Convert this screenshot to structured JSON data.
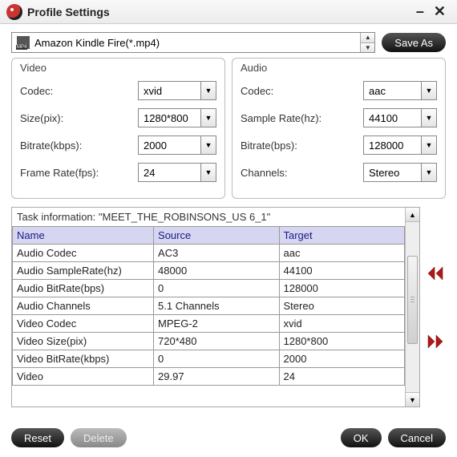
{
  "window": {
    "title": "Profile Settings"
  },
  "profile": {
    "selected": "Amazon Kindle Fire(*.mp4)",
    "save_as": "Save As"
  },
  "video": {
    "legend": "Video",
    "codec_label": "Codec:",
    "codec": "xvid",
    "size_label": "Size(pix):",
    "size": "1280*800",
    "bitrate_label": "Bitrate(kbps):",
    "bitrate": "2000",
    "fps_label": "Frame Rate(fps):",
    "fps": "24"
  },
  "audio": {
    "legend": "Audio",
    "codec_label": "Codec:",
    "codec": "aac",
    "rate_label": "Sample Rate(hz):",
    "rate": "44100",
    "bitrate_label": "Bitrate(bps):",
    "bitrate": "128000",
    "channels_label": "Channels:",
    "channels": "Stereo"
  },
  "task": {
    "title": "Task information: \"MEET_THE_ROBINSONS_US 6_1\"",
    "headers": {
      "name": "Name",
      "source": "Source",
      "target": "Target"
    },
    "rows": [
      {
        "n": "Audio Codec",
        "s": "AC3",
        "t": "aac"
      },
      {
        "n": "Audio SampleRate(hz)",
        "s": "48000",
        "t": "44100"
      },
      {
        "n": "Audio BitRate(bps)",
        "s": "0",
        "t": "128000"
      },
      {
        "n": "Audio Channels",
        "s": "5.1 Channels",
        "t": "Stereo"
      },
      {
        "n": "Video Codec",
        "s": "MPEG-2",
        "t": "xvid"
      },
      {
        "n": "Video Size(pix)",
        "s": "720*480",
        "t": "1280*800"
      },
      {
        "n": "Video BitRate(kbps)",
        "s": "0",
        "t": "2000"
      },
      {
        "n": "Video",
        "s": "29.97",
        "t": "24"
      }
    ]
  },
  "footer": {
    "reset": "Reset",
    "delete": "Delete",
    "ok": "OK",
    "cancel": "Cancel"
  }
}
